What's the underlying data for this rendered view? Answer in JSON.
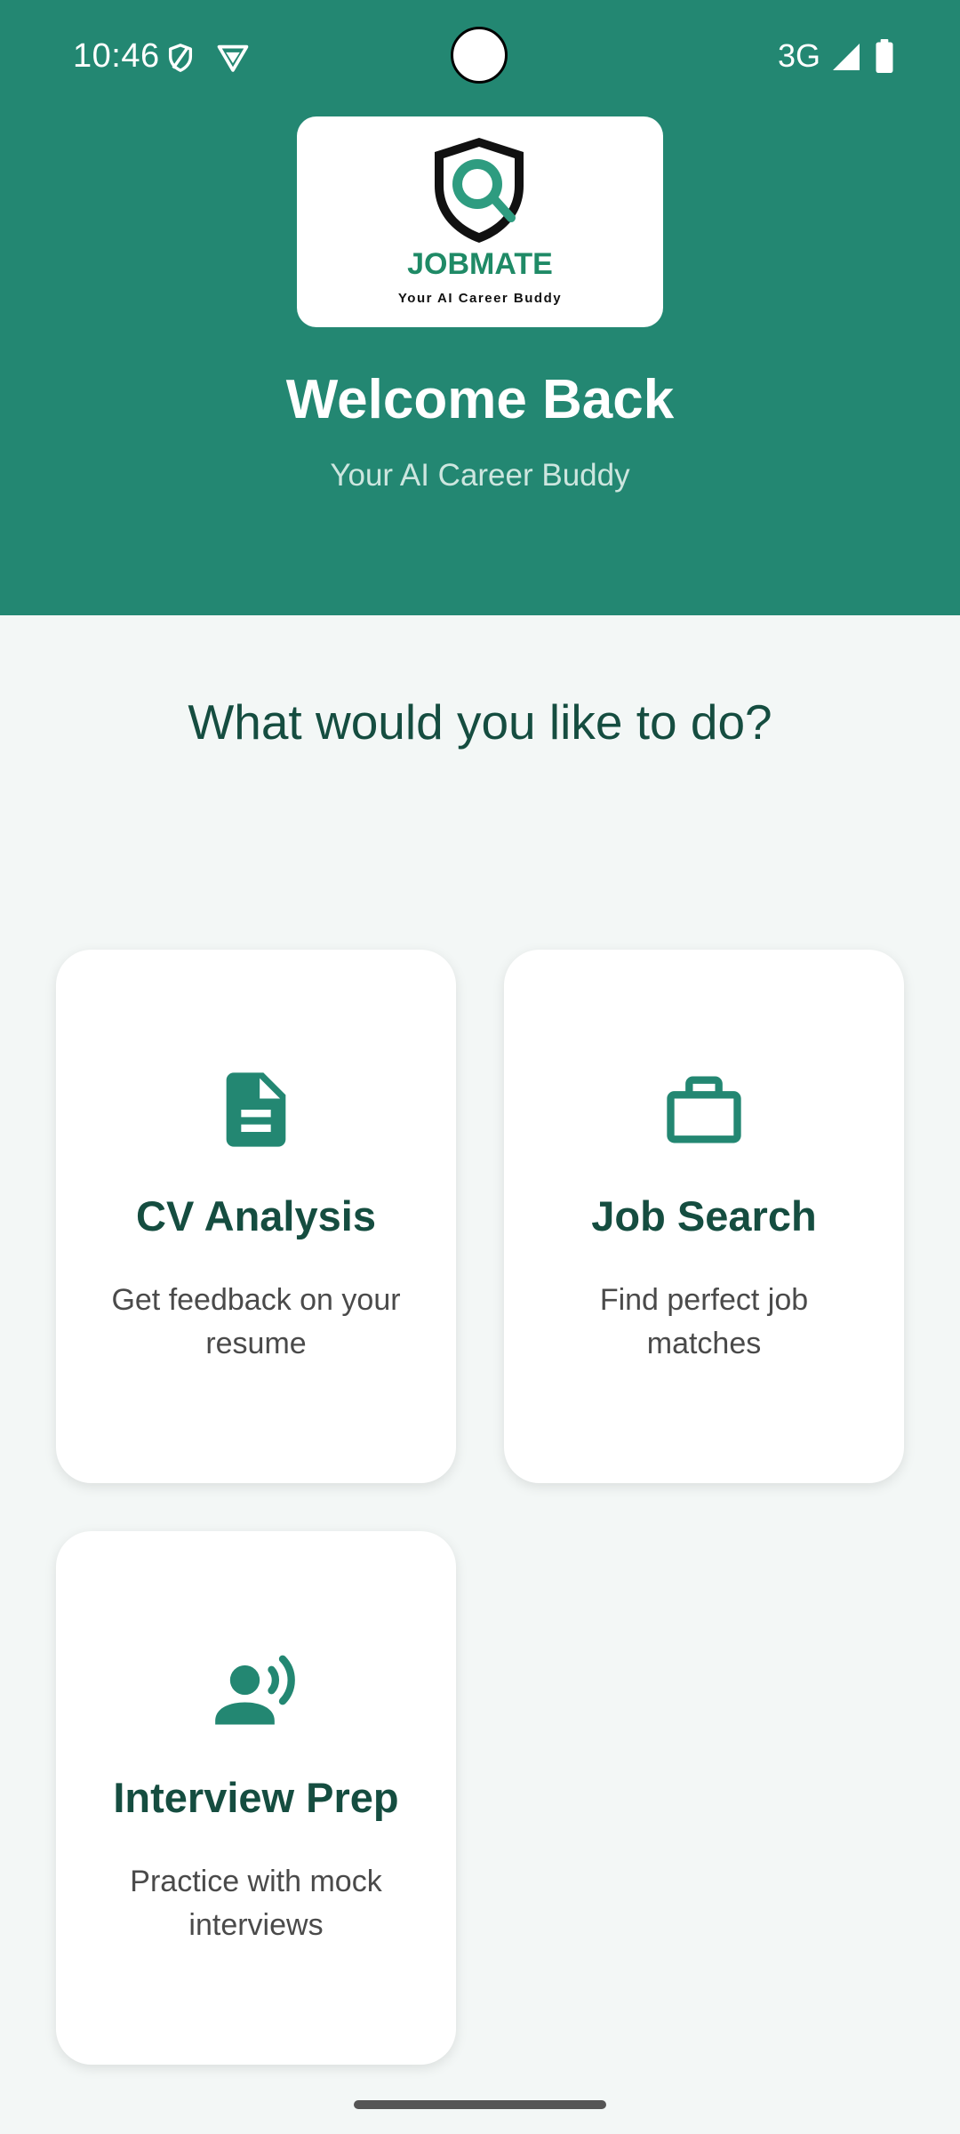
{
  "status_bar": {
    "time": "10:46",
    "network": "3G",
    "icons": [
      "shield-icon",
      "vpn-icon",
      "signal-icon",
      "battery-icon"
    ]
  },
  "header": {
    "logo": {
      "name": "JOBMATE",
      "tagline": "Your AI Career Buddy"
    },
    "title": "Welcome Back",
    "subtitle": "Your AI Career Buddy"
  },
  "main": {
    "heading": "What would you like to do?",
    "cards": [
      {
        "title": "CV Analysis",
        "description": "Get feedback on your resume",
        "icon": "document-icon"
      },
      {
        "title": "Job Search",
        "description": "Find perfect job matches",
        "icon": "briefcase-icon"
      },
      {
        "title": "Interview Prep",
        "description": "Practice with mock interviews",
        "icon": "speaking-person-icon"
      }
    ]
  },
  "colors": {
    "primary": "#238772",
    "heading_text": "#154D40",
    "background": "#F3F7F6",
    "card": "#FFFFFF",
    "logo_accent": "#1F8A66"
  }
}
